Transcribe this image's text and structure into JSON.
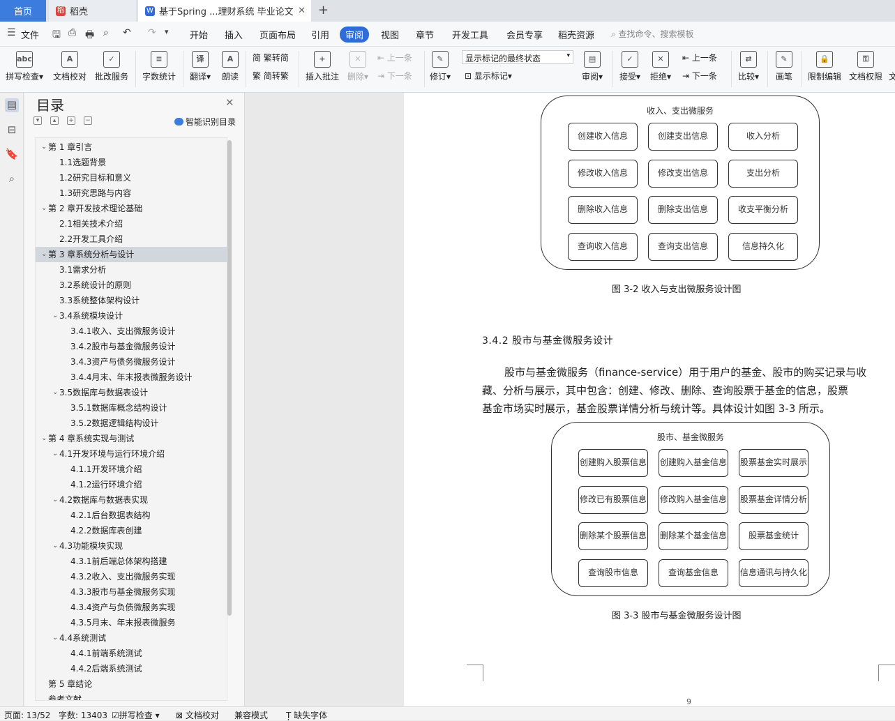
{
  "tabs": {
    "home": "首页",
    "daoke": "稻壳",
    "doc": "基于Spring ...理财系统 毕业论文",
    "new_tab": "+"
  },
  "menu": {
    "file": "文件",
    "items": [
      "开始",
      "插入",
      "页面布局",
      "引用",
      "审阅",
      "视图",
      "章节",
      "开发工具",
      "会员专享",
      "稻壳资源"
    ],
    "active": "审阅",
    "search": "查找命令、搜索模板"
  },
  "ribbon": {
    "spell": "拼写检查",
    "proof": "文档校对",
    "batch": "批改服务",
    "count": "字数统计",
    "translate": "翻译",
    "read": "朗读",
    "trad": "繁转简",
    "simp": "简转繁",
    "insert_comment": "插入批注",
    "delete": "删除",
    "prev": "上一条",
    "next": "下一条",
    "revise": "修订",
    "markup_select": "显示标记的最终状态",
    "show_markup": "显示标记",
    "review": "审阅",
    "accept": "接受",
    "reject": "拒绝",
    "prev2": "上一条",
    "next2": "下一条",
    "compare": "比较",
    "pen": "画笔",
    "restrict": "限制编辑",
    "rights": "文档权限",
    "cut": "文"
  },
  "toc": {
    "title": "目录",
    "smart": "智能识别目录",
    "items": [
      {
        "text": "第 1 章引言",
        "level": 1,
        "arrow": true
      },
      {
        "text": "1.1选题背景",
        "level": 2
      },
      {
        "text": "1.2研究目标和意义",
        "level": 2
      },
      {
        "text": "1.3研究思路与内容",
        "level": 2
      },
      {
        "text": "第 2 章开发技术理论基础",
        "level": 1,
        "arrow": true
      },
      {
        "text": "2.1相关技术介绍",
        "level": 2
      },
      {
        "text": "2.2开发工具介绍",
        "level": 2
      },
      {
        "text": "第 3 章系统分析与设计",
        "level": 1,
        "arrow": true,
        "selected": true
      },
      {
        "text": "3.1需求分析",
        "level": 2
      },
      {
        "text": "3.2系统设计的原则",
        "level": 2
      },
      {
        "text": "3.3系统整体架构设计",
        "level": 2
      },
      {
        "text": "3.4系统模块设计",
        "level": 2,
        "arrow": true
      },
      {
        "text": "3.4.1收入、支出微服务设计",
        "level": 3
      },
      {
        "text": "3.4.2股市与基金微服务设计",
        "level": 3
      },
      {
        "text": "3.4.3资产与债务微服务设计",
        "level": 3
      },
      {
        "text": "3.4.4月末、年末报表微服务设计",
        "level": 3
      },
      {
        "text": "3.5数据库与数据表设计",
        "level": 2,
        "arrow": true
      },
      {
        "text": "3.5.1数据库概念结构设计",
        "level": 3
      },
      {
        "text": "3.5.2数据逻辑结构设计",
        "level": 3
      },
      {
        "text": "第 4 章系统实现与测试",
        "level": 1,
        "arrow": true
      },
      {
        "text": "4.1开发环境与运行环境介绍",
        "level": 2,
        "arrow": true
      },
      {
        "text": "4.1.1开发环境介绍",
        "level": 3
      },
      {
        "text": "4.1.2运行环境介绍",
        "level": 3
      },
      {
        "text": "4.2数据库与数据表实现",
        "level": 2,
        "arrow": true
      },
      {
        "text": "4.2.1后台数据表结构",
        "level": 3
      },
      {
        "text": "4.2.2数据库表创建",
        "level": 3
      },
      {
        "text": "4.3功能模块实现",
        "level": 2,
        "arrow": true
      },
      {
        "text": "4.3.1前后端总体架构搭建",
        "level": 3
      },
      {
        "text": "4.3.2收入、支出微服务实现",
        "level": 3
      },
      {
        "text": "4.3.3股市与基金微服务实现",
        "level": 3
      },
      {
        "text": "4.3.4资产与负债微服务实现",
        "level": 3
      },
      {
        "text": "4.3.5月末、年末报表微服务",
        "level": 3
      },
      {
        "text": "4.4系统测试",
        "level": 2,
        "arrow": true
      },
      {
        "text": "4.4.1前端系统测试",
        "level": 3
      },
      {
        "text": "4.4.2后端系统测试",
        "level": 3
      },
      {
        "text": "第 5 章结论",
        "level": 1
      },
      {
        "text": "参考文献",
        "level": 1
      }
    ]
  },
  "doc": {
    "diagram1": {
      "title": "收入、支出微服务",
      "boxes": [
        "创建收入信息",
        "创建支出信息",
        "收入分析",
        "修改收入信息",
        "修改支出信息",
        "支出分析",
        "删除收入信息",
        "删除支出信息",
        "收支平衡分析",
        "查询收入信息",
        "查询支出信息",
        "信息持久化"
      ]
    },
    "caption1": "图 3-2 收入与支出微服务设计图",
    "heading": "3.4.2 股市与基金微服务设计",
    "para_lines": [
      "股市与基金微服务（finance-service）用于用户的基金、股市的购买记录与收",
      "藏、分析与展示，其中包含：创建、修改、删除、查询股票于基金的信息，股票",
      "基金市场实时展示，基金股票详情分析与统计等。具体设计如图 3-3 所示。"
    ],
    "diagram2": {
      "title": "股市、基金微服务",
      "boxes": [
        "创建购入股票信息",
        "创建购入基金信息",
        "股票基金实时展示",
        "修改已有股票信息",
        "修改购入基金信息",
        "股票基金详情分析",
        "删除某个股票信息",
        "删除某个基金信息",
        "股票基金统计",
        "查询股市信息",
        "查询基金信息",
        "信息通讯与持久化"
      ]
    },
    "caption2": "图 3-3 股市与基金微服务设计图",
    "page_number": "9"
  },
  "status": {
    "page": "页面: 13/52",
    "words": "字数: 13403",
    "spell": "拼写检查",
    "proof": "文档校对",
    "compat": "兼容模式",
    "missing_font": "缺失字体"
  },
  "colors": {
    "accent": "#3b7cde",
    "active_tab": "#2f6cd8"
  }
}
